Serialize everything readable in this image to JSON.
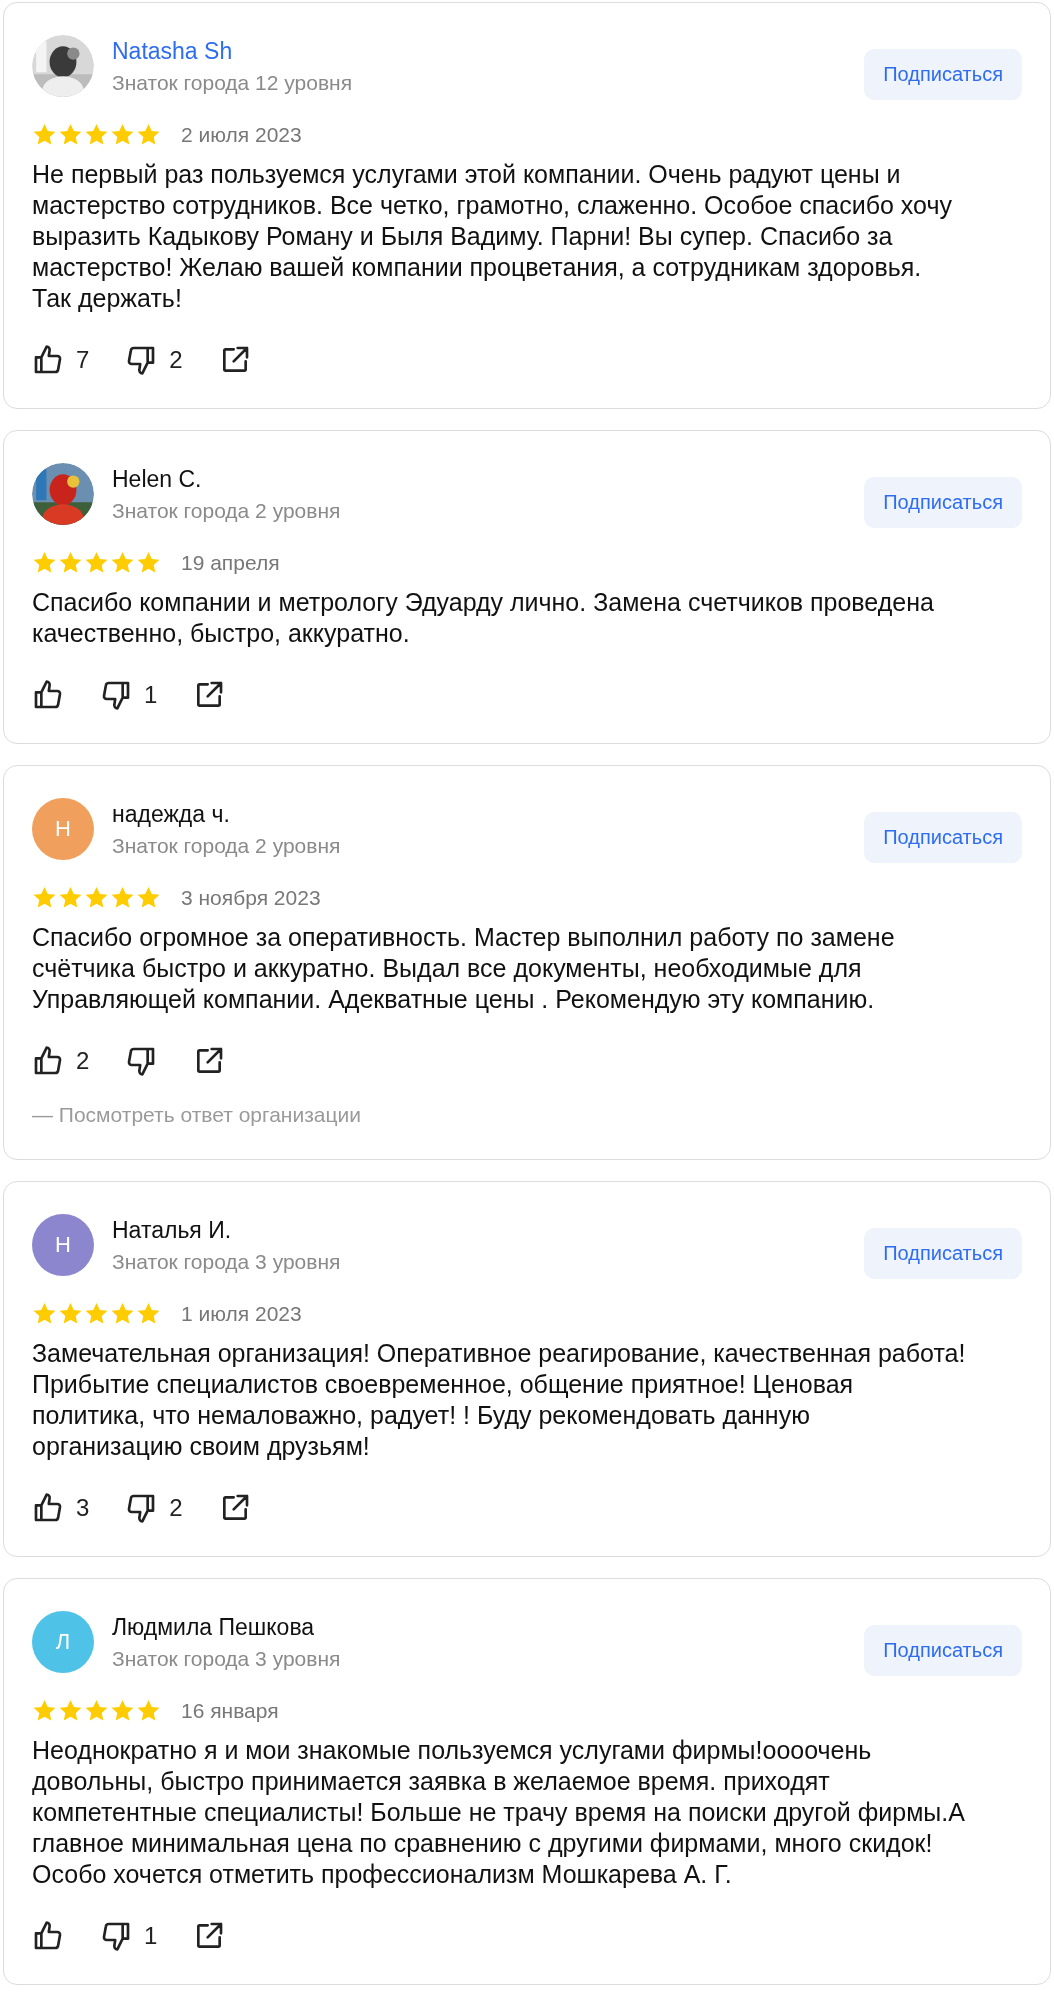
{
  "reviews": [
    {
      "author": {
        "name": "Natasha Sh",
        "highlighted": true,
        "level": "Знаток города 12 уровня"
      },
      "subscribe": "Подписаться",
      "stars": 5,
      "date": "2 июля 2023",
      "text": "Не первый раз пользуемся услугами этой компании. Очень радуют цены и мастерство сотрудников. Все четко, грамотно, слаженно. Особое спасибо хочу выразить Кадыкову Роману и Быля Вадиму. Парни! Вы супер. Спасибо за мастерство! Желаю вашей компании процветания, а сотрудникам здоровья. Так держать!",
      "likes": "7",
      "dislikes": "2"
    },
    {
      "author": {
        "name": "Helen C.",
        "highlighted": false,
        "level": "Знаток города 2 уровня"
      },
      "subscribe": "Подписаться",
      "stars": 5,
      "date": "19 апреля",
      "text": "Спасибо компании и метрологу Эдуарду лично. Замена счетчиков проведена качественно, быстро, аккуратно.",
      "dislikes": "1"
    },
    {
      "author": {
        "name": "надежда ч.",
        "highlighted": false,
        "avatar": {
          "kind": "letter",
          "letter": "Н",
          "color": "#f0a05c"
        },
        "level": "Знаток города 2 уровня"
      },
      "subscribe": "Подписаться",
      "stars": 5,
      "date": "3 ноября 2023",
      "text": "Спасибо огромное за оперативность. Мастер выполнил работу по замене счётчика быстро и аккуратно. Выдал все документы, необходимые для Управляющей компании. Адекватные цены . Рекомендую эту компанию.",
      "likes": "2",
      "reply_link": "— Посмотреть ответ организации"
    },
    {
      "author": {
        "name": "Наталья И.",
        "highlighted": false,
        "avatar": {
          "kind": "letter",
          "letter": "Н",
          "color": "#8c86cf"
        },
        "level": "Знаток города 3 уровня"
      },
      "subscribe": "Подписаться",
      "stars": 5,
      "date": "1 июля 2023",
      "text": "Замечательная организация! Оперативное реагирование, качественная работа! Прибытие специалистов своевременное, общение приятное! Ценовая политика, что немаловажно, радует! ! Буду рекомендовать данную организацию своим друзьям!",
      "likes": "3",
      "dislikes": "2"
    },
    {
      "author": {
        "name": "Людмила Пешкова",
        "highlighted": false,
        "avatar": {
          "kind": "letter",
          "letter": "Л",
          "color": "#4fc2e8"
        },
        "level": "Знаток города 3 уровня"
      },
      "subscribe": "Подписаться",
      "stars": 5,
      "date": "16 января",
      "text": "Неоднократно я и мои знакомые пользуемся услугами фирмы!оооочень довольны, быстро принимается заявка в желаемое время. приходят компетентные специалисты! Больше не трачу время на поиски другой фирмы.А главное минимальная цена по сравнению с другими фирмами, много скидок! Особо хочется отметить профессионализм Мошкарева А. Г.",
      "dislikes": "1"
    }
  ]
}
